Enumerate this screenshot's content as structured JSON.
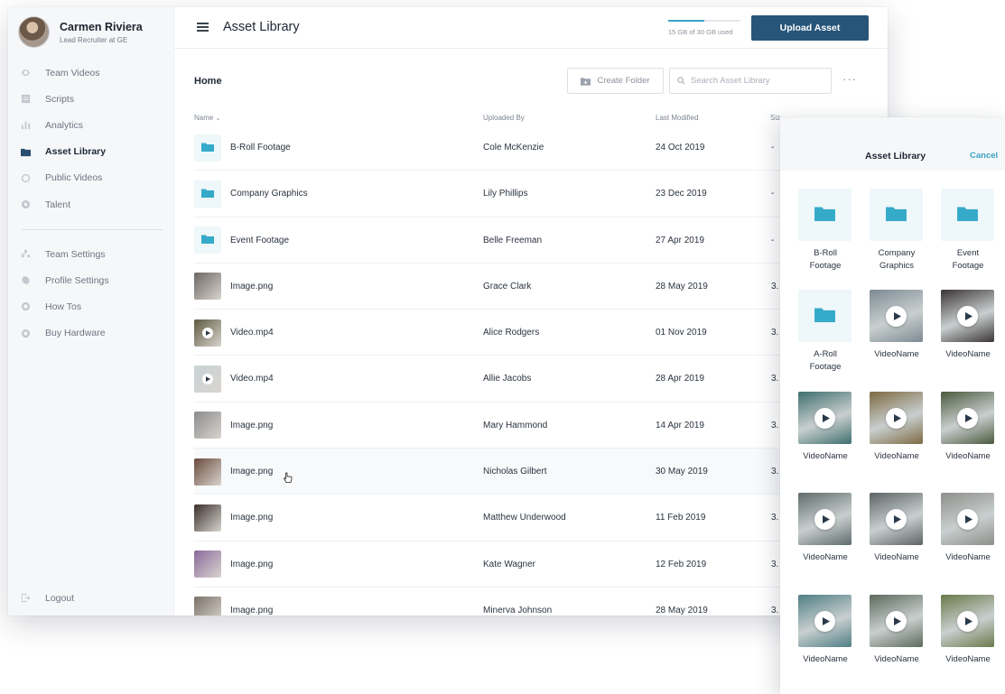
{
  "user": {
    "name": "Carmen Riviera",
    "role": "Lead Recruiter at GE"
  },
  "nav": [
    {
      "label": "Team Videos",
      "icon": "eye-icon",
      "active": false
    },
    {
      "label": "Scripts",
      "icon": "script-icon",
      "active": false
    },
    {
      "label": "Analytics",
      "icon": "analytics-icon",
      "active": false
    },
    {
      "label": "Asset Library",
      "icon": "folder-icon",
      "active": true
    },
    {
      "label": "Public Videos",
      "icon": "globe-icon",
      "active": false
    },
    {
      "label": "Talent",
      "icon": "target-icon",
      "active": false
    }
  ],
  "nav2": [
    {
      "label": "Team Settings",
      "icon": "team-icon"
    },
    {
      "label": "Profile Settings",
      "icon": "gear-icon"
    },
    {
      "label": "How Tos",
      "icon": "help-icon"
    },
    {
      "label": "Buy Hardware",
      "icon": "hardware-icon"
    }
  ],
  "logout": "Logout",
  "header": {
    "title": "Asset Library",
    "storage_text": "15 GB of 30 GB used",
    "storage_used": 0.5,
    "upload_label": "Upload Asset"
  },
  "toolbar": {
    "breadcrumb": "Home",
    "create_folder": "Create Folder",
    "search_placeholder": "Search Asset Library"
  },
  "columns": {
    "name": "Name",
    "uploaded_by": "Uploaded By",
    "last_modified": "Last Modified",
    "size": "Siz"
  },
  "rows": [
    {
      "name": "B-Roll Footage",
      "by": "Cole McKenzie",
      "date": "24 Oct 2019",
      "size": "-",
      "type": "folder",
      "thumb": "#eef7fa"
    },
    {
      "name": "Company Graphics",
      "by": "Lily Phillips",
      "date": "23 Dec 2019",
      "size": "-",
      "type": "folder",
      "thumb": "#eef7fa"
    },
    {
      "name": "Event Footage",
      "by": "Belle Freeman",
      "date": "27 Apr 2019",
      "size": "-",
      "type": "folder",
      "thumb": "#eef7fa"
    },
    {
      "name": "Image.png",
      "by": "Grace Clark",
      "date": "28 May 2019",
      "size": "3.",
      "type": "image",
      "thumb": "#6d6763"
    },
    {
      "name": "Video.mp4",
      "by": "Alice Rodgers",
      "date": "01 Nov 2019",
      "size": "3.",
      "type": "video",
      "thumb": "#5e5a3e"
    },
    {
      "name": "Video.mp4",
      "by": "Allie Jacobs",
      "date": "28 Apr 2019",
      "size": "3.",
      "type": "video",
      "thumb": "#c9d3d6"
    },
    {
      "name": "Image.png",
      "by": "Mary Hammond",
      "date": "14 Apr 2019",
      "size": "3.",
      "type": "image",
      "thumb": "#8c8c8c"
    },
    {
      "name": "Image.png",
      "by": "Nicholas Gilbert",
      "date": "30 May 2019",
      "size": "3.",
      "type": "image",
      "thumb": "#6b4a3d"
    },
    {
      "name": "Image.png",
      "by": "Matthew Underwood",
      "date": "11 Feb 2019",
      "size": "3.",
      "type": "image",
      "thumb": "#3a2f2a"
    },
    {
      "name": "Image.png",
      "by": "Kate Wagner",
      "date": "12 Feb 2019",
      "size": "3.",
      "type": "image",
      "thumb": "#8a6a9a"
    },
    {
      "name": "Image.png",
      "by": "Minerva Johnson",
      "date": "28 May 2019",
      "size": "3.",
      "type": "image",
      "thumb": "#7b7268"
    }
  ],
  "panel": {
    "title": "Asset Library",
    "cancel": "Cancel",
    "tiles": [
      {
        "label": "B-Roll Footage",
        "type": "folder",
        "color": "#eef7fa"
      },
      {
        "label": "Company Graphics",
        "type": "folder",
        "color": "#eef7fa"
      },
      {
        "label": "Event Footage",
        "type": "folder",
        "color": "#eef7fa"
      },
      {
        "label": "A-Roll Footage",
        "type": "folder",
        "color": "#eef7fa"
      },
      {
        "label": "VideoName",
        "type": "video",
        "color": "#7d8a93"
      },
      {
        "label": "VideoName",
        "type": "video",
        "color": "#3b3434"
      },
      {
        "label": "VideoName",
        "type": "video",
        "color": "#3e6f6e"
      },
      {
        "label": "VideoName",
        "type": "video",
        "color": "#7d6a42"
      },
      {
        "label": "VideoName",
        "type": "video",
        "color": "#4b5a3e"
      },
      {
        "label": "VideoName",
        "type": "video",
        "color": "#5f6b6b"
      },
      {
        "label": "VideoName",
        "type": "video",
        "color": "#5d6466"
      },
      {
        "label": "VideoName",
        "type": "video",
        "color": "#8c8f8a"
      },
      {
        "label": "VideoName",
        "type": "video",
        "color": "#4f7f85"
      },
      {
        "label": "VideoName",
        "type": "video",
        "color": "#5c6a5c"
      },
      {
        "label": "VideoName",
        "type": "video",
        "color": "#6a7a4a"
      }
    ]
  },
  "colors": {
    "accent": "#3aa3c4",
    "primary": "#27557a"
  }
}
